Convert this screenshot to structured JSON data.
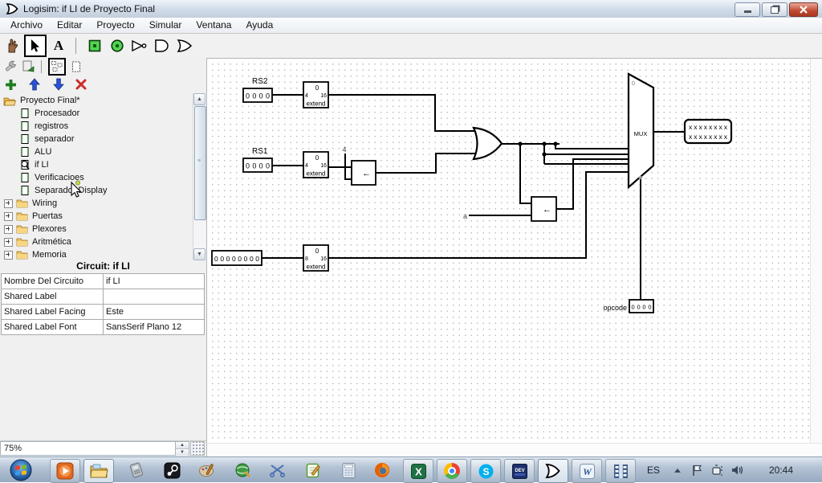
{
  "window": {
    "title": "Logisim: if LI de Proyecto Final"
  },
  "menu": {
    "items": [
      "Archivo",
      "Editar",
      "Proyecto",
      "Simular",
      "Ventana",
      "Ayuda"
    ]
  },
  "explorer": {
    "root": "Proyecto Final*",
    "circuits": [
      "Procesador",
      "registros",
      "separador",
      "ALU",
      "if LI",
      "Verificacioes",
      "Separador Display"
    ],
    "libraries": [
      "Wiring",
      "Puertas",
      "Plexores",
      "Aritmética",
      "Memoria"
    ]
  },
  "attributes": {
    "header": "Circuit: if LI",
    "rows": [
      {
        "label": "Nombre Del Circuito",
        "value": "if LI"
      },
      {
        "label": "Shared Label",
        "value": ""
      },
      {
        "label": "Shared Label Facing",
        "value": "Este"
      },
      {
        "label": "Shared Label Font",
        "value": "SansSerif Plano 12"
      }
    ]
  },
  "statusbar": {
    "zoom": "75%"
  },
  "circuit": {
    "rs2_label": "RS2",
    "rs1_label": "RS1",
    "opcode_label": "opcode",
    "pin_rs2": "0 0 0 0",
    "pin_rs1": "0 0 0 0",
    "pin_imm": "0 0 0 0 0 0 0 0",
    "pin_opcode": "0 0 0 0",
    "out_bits_row1": "x x x x x x x x",
    "out_bits_row2": "x x x x x x x x",
    "ext_top": "0",
    "ext_in4": "4",
    "ext_in8": "8",
    "ext_out": "16",
    "ext_label": "extend",
    "shift_arrow": "←",
    "const_4": "4",
    "const_a": "a",
    "mux_label": "MUX",
    "mux_zero": "0"
  },
  "taskbar": {
    "language": "ES",
    "time": "20:44"
  }
}
